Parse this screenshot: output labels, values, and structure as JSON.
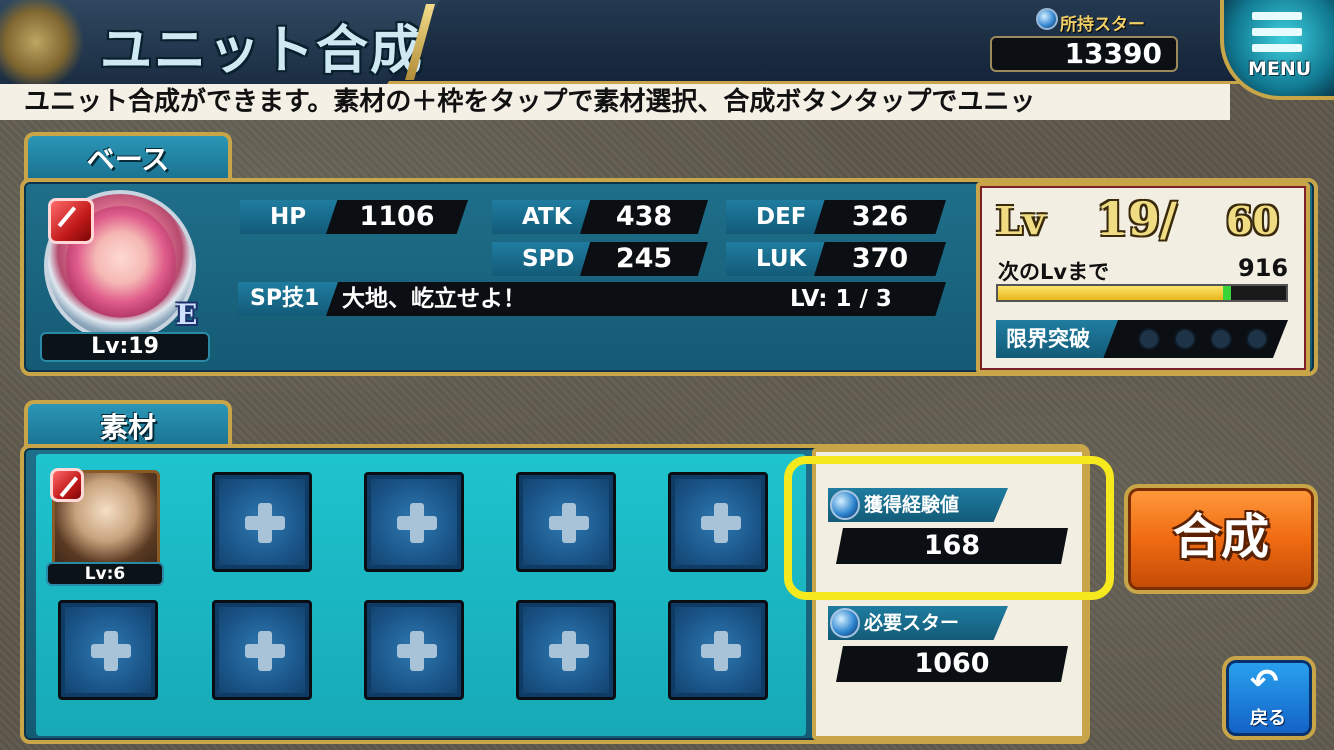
{
  "header": {
    "title": "ユニット合成",
    "star_label": "所持スター",
    "star_value": "13390",
    "menu_label": "MENU"
  },
  "instruction": "ユニット合成ができます。素材の＋枠をタップで素材選択、合成ボタンタップでユニッ",
  "base": {
    "tab_label": "ベース",
    "unit_level": "Lv:19",
    "grade": "E",
    "stats": {
      "hp_label": "HP",
      "hp_value": "1106",
      "atk_label": "ATK",
      "atk_value": "438",
      "def_label": "DEF",
      "def_value": "326",
      "spd_label": "SPD",
      "spd_value": "245",
      "luk_label": "LUK",
      "luk_value": "370"
    },
    "sp": {
      "label": "SP技1",
      "name": "大地、屹立せよ！",
      "level": "LV: 1 / 3"
    },
    "level_card": {
      "lv_word": "Lv",
      "current": "19/",
      "max": "60",
      "next_label": "次のLvまで",
      "next_value": "916",
      "exp_fraction": 0.78,
      "limit_label": "限界突破",
      "limit_slots": 4
    }
  },
  "material": {
    "tab_label": "素材",
    "unit_level": "Lv:6",
    "empty_slot_count": 9
  },
  "info": {
    "exp_label": "獲得経験値",
    "exp_value": "168",
    "star_label": "必要スター",
    "star_value": "1060"
  },
  "actions": {
    "fuse_label": "合成",
    "back_label": "戻る"
  },
  "colors": {
    "accent_gold": "#c9a54a",
    "highlight": "#f6ea1e",
    "fuse_orange": "#f06b12",
    "panel_teal": "#1f6f8a"
  }
}
